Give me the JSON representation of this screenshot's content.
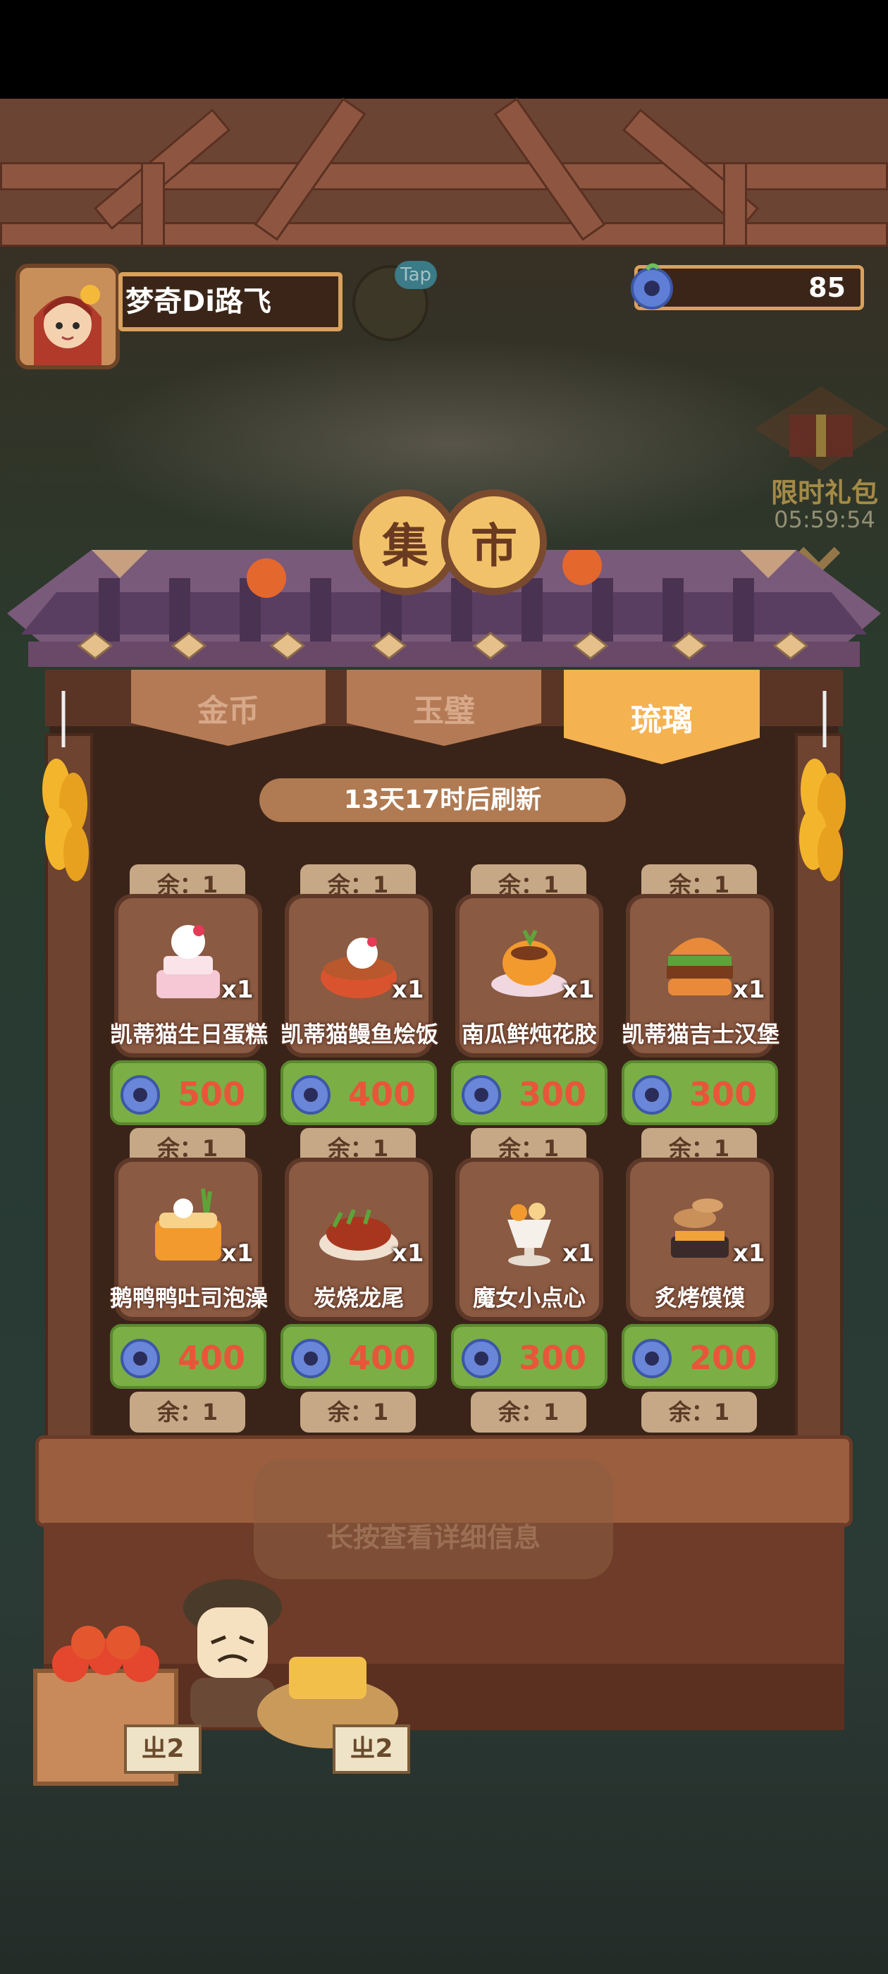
{
  "player": {
    "name": "梦奇Di路飞"
  },
  "tap_hint": "Tap",
  "currency": {
    "icon": "jade-coin-icon",
    "amount": "85"
  },
  "limited_gift": {
    "label": "限时礼包",
    "timer": "05:59:54"
  },
  "market": {
    "title_chars": [
      "集",
      "市"
    ],
    "tabs": [
      {
        "label": "金币",
        "active": false
      },
      {
        "label": "玉璧",
        "active": false
      },
      {
        "label": "琉璃",
        "active": true
      }
    ],
    "refresh_text": "13天17时后刷新",
    "items": [
      {
        "remaining": "余：1",
        "count": "x1",
        "name": "凯蒂猫生日蛋糕",
        "price": "500"
      },
      {
        "remaining": "余：1",
        "count": "x1",
        "name": "凯蒂猫鳗鱼烩饭",
        "price": "400"
      },
      {
        "remaining": "余：1",
        "count": "x1",
        "name": "南瓜鲜炖花胶",
        "price": "300"
      },
      {
        "remaining": "余：1",
        "count": "x1",
        "name": "凯蒂猫吉士汉堡",
        "price": "300"
      },
      {
        "remaining": "余：1",
        "count": "x1",
        "name": "鹅鸭鸭吐司泡澡",
        "price": "400"
      },
      {
        "remaining": "余：1",
        "count": "x1",
        "name": "炭烧龙尾",
        "price": "400"
      },
      {
        "remaining": "余：1",
        "count": "x1",
        "name": "魔女小点心",
        "price": "300"
      },
      {
        "remaining": "余：1",
        "count": "x1",
        "name": "炙烤馍馍",
        "price": "200"
      }
    ],
    "partial_row_remaining": [
      "余：1",
      "余：1",
      "余：1",
      "余：1"
    ]
  },
  "counter": {
    "hint": "长按查看详细信息",
    "signs": [
      "ㄓ2",
      "ㄓ2"
    ]
  },
  "colors": {
    "price_green": "#7cae46",
    "price_text": "#e8563a",
    "tab_active": "#f5b250",
    "accent_gold": "#d9a15c"
  }
}
